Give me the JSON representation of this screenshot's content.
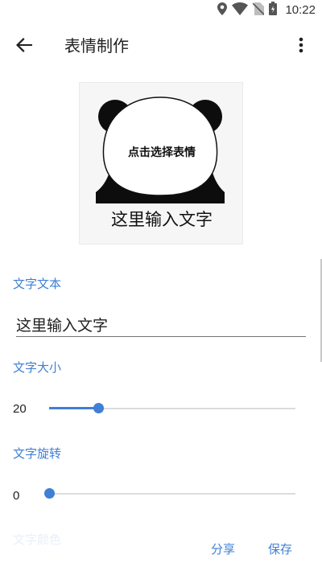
{
  "status_bar": {
    "time": "10:22",
    "icons": [
      "location-icon",
      "wifi-icon",
      "no-sim-icon",
      "battery-icon"
    ]
  },
  "app_bar": {
    "title": "表情制作",
    "back_icon": "arrow-back-icon",
    "more_icon": "more-vert-icon"
  },
  "meme": {
    "pick_text": "点击选择表情",
    "caption": "这里输入文字"
  },
  "form": {
    "text_section_label": "文字文本",
    "text_value": "这里输入文字",
    "size_section_label": "文字大小",
    "size_value": "20",
    "size_fraction": 0.2,
    "rotate_section_label": "文字旋转",
    "rotate_value": "0",
    "rotate_fraction": 0.0,
    "color_section_label": "文字颜色"
  },
  "actions": {
    "share_label": "分享",
    "save_label": "保存"
  },
  "colors": {
    "accent": "#3f7fd6",
    "text": "#212121",
    "track": "#dcdcdc"
  }
}
